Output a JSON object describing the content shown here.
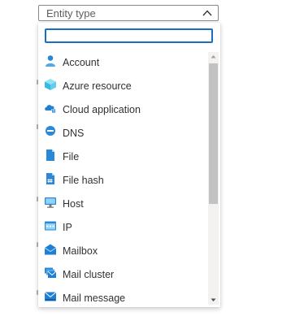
{
  "dropdown": {
    "placeholder": "Entity type",
    "expanded": true
  },
  "search": {
    "value": "",
    "placeholder": ""
  },
  "colors": {
    "accent": "#1a6ec4",
    "icon_blue": "#2b88d8",
    "icon_light": "#50e6ff",
    "thumb": "#c2c2c2"
  },
  "items": [
    {
      "label": "Account",
      "icon": "account-icon"
    },
    {
      "label": "Azure resource",
      "icon": "azure-resource-icon"
    },
    {
      "label": "Cloud application",
      "icon": "cloud-application-icon"
    },
    {
      "label": "DNS",
      "icon": "dns-icon"
    },
    {
      "label": "File",
      "icon": "file-icon"
    },
    {
      "label": "File hash",
      "icon": "file-hash-icon"
    },
    {
      "label": "Host",
      "icon": "host-icon"
    },
    {
      "label": "IP",
      "icon": "ip-icon"
    },
    {
      "label": "Mailbox",
      "icon": "mailbox-icon"
    },
    {
      "label": "Mail cluster",
      "icon": "mail-cluster-icon"
    },
    {
      "label": "Mail message",
      "icon": "mail-message-icon"
    }
  ]
}
